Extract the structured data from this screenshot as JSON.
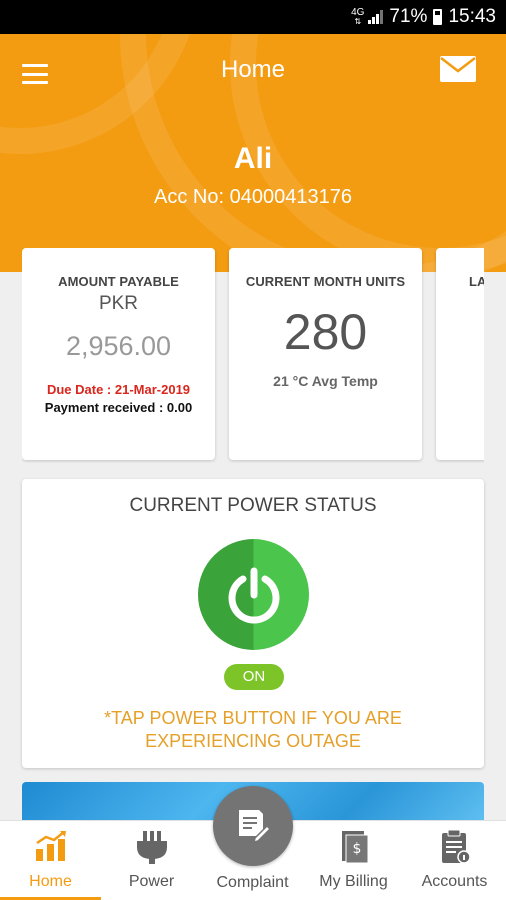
{
  "status_bar": {
    "network": "4G",
    "battery": "71%",
    "time": "15:43"
  },
  "header": {
    "title": "Home",
    "user_name": "Ali",
    "account_label": "Acc No: 04000413176"
  },
  "cards": {
    "amount_payable": {
      "title": "AMOUNT PAYABLE",
      "currency": "PKR",
      "amount": "2,956.00",
      "due_date": "Due Date : 21-Mar-2019",
      "payment_received": "Payment received : 0.00"
    },
    "current_month_units": {
      "title": "CURRENT MONTH UNITS",
      "units": "280",
      "avg_temp": "21 °C Avg Temp"
    },
    "partial_card": {
      "title_fragment": "LA"
    }
  },
  "power_status": {
    "title": "CURRENT POWER STATUS",
    "state": "ON",
    "message": "*TAP POWER BUTTON IF YOU ARE EXPERIENCING OUTAGE"
  },
  "bottom_nav": {
    "items": [
      {
        "label": "Home",
        "icon": "bar-chart-icon",
        "active": true
      },
      {
        "label": "Power",
        "icon": "plug-icon",
        "active": false
      },
      {
        "label": "Complaint",
        "icon": "complaint-edit-icon",
        "active": false
      },
      {
        "label": "My Billing",
        "icon": "bill-icon",
        "active": false
      },
      {
        "label": "Accounts",
        "icon": "accounts-clipboard-icon",
        "active": false
      }
    ]
  },
  "colors": {
    "brand": "#f39c12",
    "power_on": "#3aa33a",
    "badge_on": "#7cc428",
    "due_red": "#d9261c"
  }
}
